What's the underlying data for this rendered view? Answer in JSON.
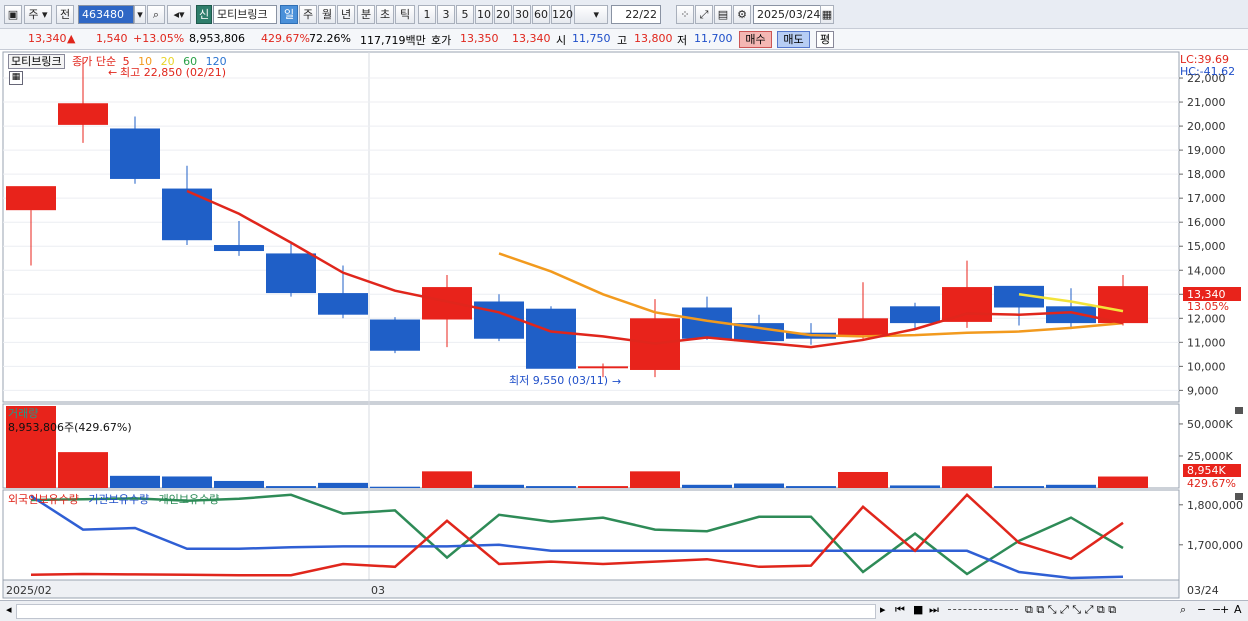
{
  "toolbar": {
    "mode_label": "주",
    "prev_label": "전",
    "stock_code": "463480",
    "new_badge": "신",
    "stock_name": "모티브링크",
    "periods": [
      "일",
      "주",
      "월",
      "년",
      "분",
      "초",
      "틱"
    ],
    "active_period": "일",
    "intervals": [
      "1",
      "3",
      "5",
      "10",
      "20",
      "30",
      "60",
      "120"
    ],
    "count": "22",
    "count_total": "/22",
    "date": "2025/03/24"
  },
  "info": {
    "price": "13,340",
    "change_arrow": "▲",
    "change": "1,540",
    "change_pct": "+13.05%",
    "volume": "8,953,806",
    "volume_ratio": "429.67%",
    "rotation": "72.26%",
    "trade_value": "117,719백만",
    "quote_label": "호가",
    "ask": "13,350",
    "bid": "13,340",
    "open_label": "시",
    "open": "11,750",
    "high_label": "고",
    "high": "13,800",
    "low_label": "저",
    "low": "11,700",
    "buy_label": "매수",
    "sell_label": "매도",
    "avg_label": "평"
  },
  "legend": {
    "name": "모티브링크",
    "ma_label": "종가 단순",
    "ma_periods": [
      "5",
      "10",
      "20",
      "60",
      "120"
    ],
    "high_annot": "최고 22,850 (02/21)",
    "low_annot": "최저 9,550 (03/11)",
    "lc": "LC:39.69",
    "hc": "HC:-41.62",
    "volume_title": "거래량",
    "volume_annot": "8,953,806주(429.67%)",
    "ind_foreign": "외국인보유수량",
    "ind_inst": "기관보유수량",
    "ind_indiv": "개인보유수량",
    "x_start": "2025/02",
    "x_mid": "03",
    "x_end": "03/24"
  },
  "colors": {
    "up": "#e8231b",
    "down": "#1f5fc7",
    "ma5": "#e0261c",
    "ma10": "#f29a1e",
    "ma20": "#f3e33a",
    "ma60": "#2aa148",
    "ma120": "#2b74d1"
  },
  "price_axis": {
    "ticks": [
      "22,000",
      "21,000",
      "20,000",
      "19,000",
      "18,000",
      "17,000",
      "16,000",
      "15,000",
      "14,000",
      "13,000",
      "12,000",
      "11,000",
      "10,000",
      "9,000"
    ],
    "current_label": "13,340",
    "current_pct": "13.05%",
    "min": 8600,
    "max": 23000
  },
  "volume_axis": {
    "ticks": [
      "50,000K",
      "25,000K"
    ],
    "current_label": "8,954K",
    "current_pct": "429.67%",
    "max": 64000
  },
  "holdings_axis": {
    "ticks": [
      "1,800,000",
      "1,700,000"
    ],
    "min": 1612000,
    "max": 1832000
  },
  "chart_data": {
    "type": "candlestick",
    "dates": [
      "02/20",
      "02/21",
      "02/24",
      "02/25",
      "02/26",
      "02/27",
      "02/28",
      "03/04",
      "03/05",
      "03/06",
      "03/07",
      "03/10",
      "03/11",
      "03/12",
      "03/13",
      "03/14",
      "03/17",
      "03/18",
      "03/19",
      "03/20",
      "03/21",
      "03/24"
    ],
    "open": [
      16500,
      20050,
      19900,
      17400,
      15050,
      14700,
      13050,
      11950,
      11950,
      12700,
      12400,
      9920,
      9850,
      12450,
      11800,
      11400,
      11300,
      12500,
      11850,
      13350,
      12500,
      11800
    ],
    "high": [
      16500,
      22850,
      20400,
      18350,
      16050,
      15200,
      14200,
      12050,
      13800,
      13000,
      12500,
      10120,
      12800,
      12900,
      12150,
      11800,
      13500,
      12650,
      14400,
      13300,
      13250,
      13800
    ],
    "low": [
      14200,
      19300,
      17600,
      15050,
      14600,
      12900,
      12000,
      10550,
      10800,
      11050,
      10350,
      9550,
      9550,
      11100,
      11000,
      10900,
      11150,
      11550,
      11600,
      11700,
      11550,
      11700
    ],
    "close": [
      17500,
      20950,
      17800,
      15250,
      14800,
      13050,
      12150,
      10650,
      13300,
      11150,
      9900,
      10000,
      12000,
      11150,
      11050,
      11150,
      12000,
      11800,
      13300,
      12450,
      11800,
      13340
    ],
    "ma5_start": 3,
    "ma5": [
      null,
      null,
      null,
      17300,
      16350,
      15150,
      13900,
      13150,
      12700,
      12250,
      11450,
      11250,
      10950,
      11200,
      11000,
      10800,
      11100,
      11550,
      12200,
      12150,
      12250,
      11800
    ],
    "ma10_start": 9,
    "ma10": [
      null,
      null,
      null,
      null,
      null,
      null,
      null,
      null,
      null,
      14700,
      13950,
      13000,
      12250,
      11900,
      11600,
      11300,
      11250,
      11300,
      11400,
      11450,
      11600,
      11800
    ],
    "ma20_start": 19,
    "ma20": [
      null,
      null,
      null,
      null,
      null,
      null,
      null,
      null,
      null,
      null,
      null,
      null,
      null,
      null,
      null,
      null,
      null,
      null,
      null,
      13000,
      12700,
      12300
    ],
    "volume": [
      64000,
      28000,
      9500,
      9000,
      5500,
      1500,
      4000,
      1000,
      13000,
      2500,
      1500,
      1500,
      13000,
      2500,
      3500,
      1500,
      12500,
      2000,
      17000,
      1500,
      2500,
      8954
    ],
    "foreign_holding": [
      1625000,
      1627000,
      1626000,
      1625000,
      1624000,
      1624000,
      1652000,
      1645000,
      1760000,
      1652000,
      1658000,
      1652000,
      1658000,
      1664000,
      1645000,
      1648000,
      1795000,
      1685000,
      1825000,
      1705000,
      1665000,
      1755000
    ],
    "inst_holding": [
      1822000,
      1738000,
      1742000,
      1690000,
      1690000,
      1694000,
      1696000,
      1696000,
      1696000,
      1700000,
      1685000,
      1685000,
      1685000,
      1685000,
      1685000,
      1685000,
      1685000,
      1685000,
      1685000,
      1632000,
      1617000,
      1620000
    ],
    "indiv_holding": [
      1812000,
      1814000,
      1816000,
      1810000,
      1815000,
      1825000,
      1778000,
      1786000,
      1668000,
      1775000,
      1758000,
      1768000,
      1738000,
      1734000,
      1770000,
      1770000,
      1632000,
      1728000,
      1627000,
      1710000,
      1768000,
      1692000
    ]
  }
}
